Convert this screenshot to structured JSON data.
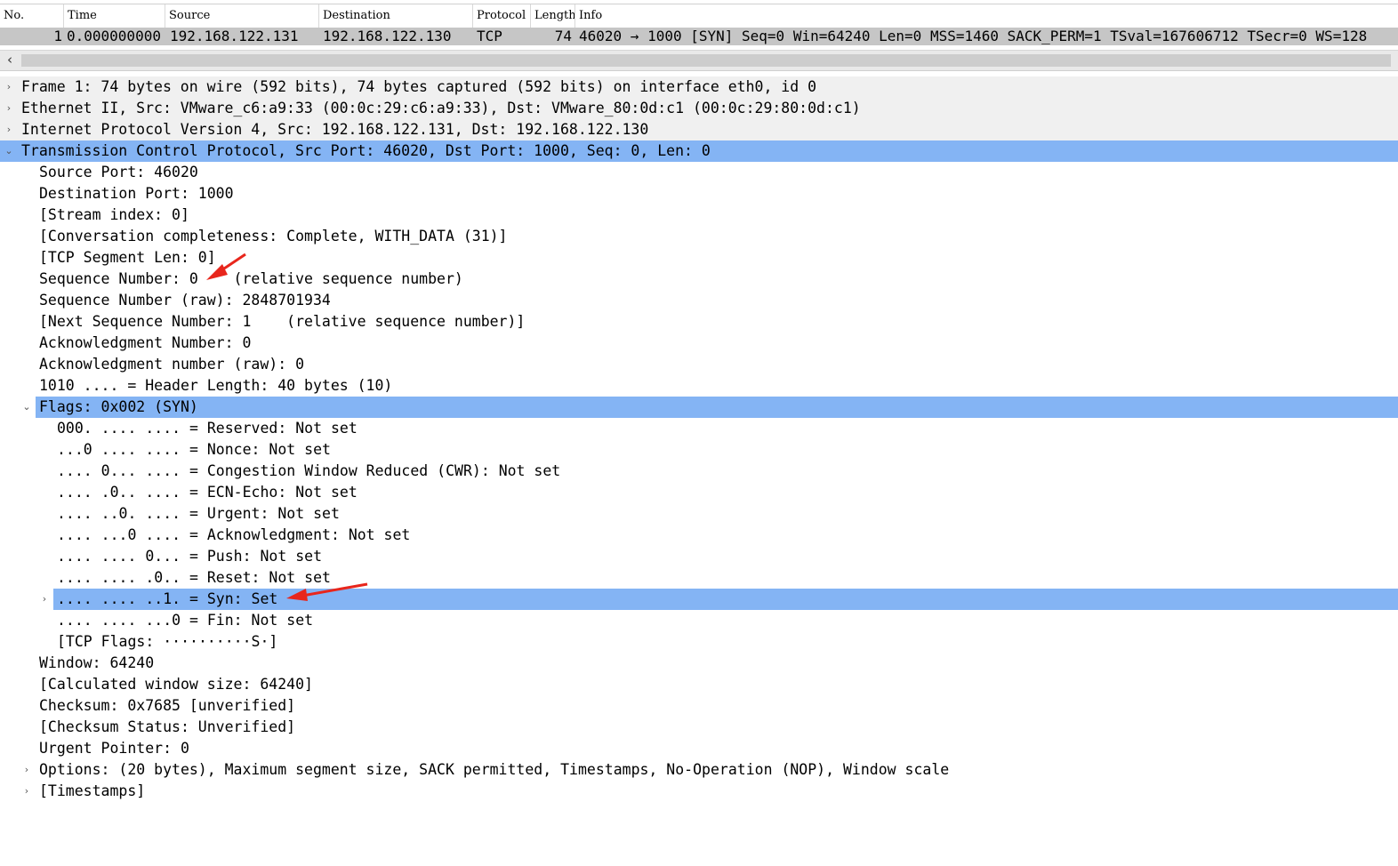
{
  "packet_list": {
    "columns": [
      "No.",
      "Time",
      "Source",
      "Destination",
      "Protocol",
      "Length",
      "Info"
    ],
    "row": {
      "no": "1",
      "time": "0.000000000",
      "source": "192.168.122.131",
      "destination": "192.168.122.130",
      "protocol": "TCP",
      "length": "74",
      "info": "46020 → 1000 [SYN] Seq=0 Win=64240 Len=0 MSS=1460 SACK_PERM=1 TSval=167606712 TSecr=0 WS=128"
    },
    "scroll_left_icon": "‹"
  },
  "tree": {
    "frame": "Frame 1: 74 bytes on wire (592 bits), 74 bytes captured (592 bits) on interface eth0, id 0",
    "ethernet": "Ethernet II, Src: VMware_c6:a9:33 (00:0c:29:c6:a9:33), Dst: VMware_80:0d:c1 (00:0c:29:80:0d:c1)",
    "ip": "Internet Protocol Version 4, Src: 192.168.122.131, Dst: 192.168.122.130",
    "tcp": "Transmission Control Protocol, Src Port: 46020, Dst Port: 1000, Seq: 0, Len: 0",
    "tcp_fields": {
      "src_port": "Source Port: 46020",
      "dst_port": "Destination Port: 1000",
      "stream_index": "[Stream index: 0]",
      "conversation": "[Conversation completeness: Complete, WITH_DATA (31)]",
      "segment_len": "[TCP Segment Len: 0]",
      "seq": "Sequence Number: 0    (relative sequence number)",
      "seq_raw": "Sequence Number (raw): 2848701934",
      "next_seq": "[Next Sequence Number: 1    (relative sequence number)]",
      "ack": "Acknowledgment Number: 0",
      "ack_raw": "Acknowledgment number (raw): 0",
      "header_len": "1010 .... = Header Length: 40 bytes (10)",
      "flags": "Flags: 0x002 (SYN)",
      "window": "Window: 64240",
      "calc_window": "[Calculated window size: 64240]",
      "checksum": "Checksum: 0x7685 [unverified]",
      "checksum_status": "[Checksum Status: Unverified]",
      "urgent_ptr": "Urgent Pointer: 0",
      "options": "Options: (20 bytes), Maximum segment size, SACK permitted, Timestamps, No-Operation (NOP), Window scale",
      "timestamps": "[Timestamps]"
    },
    "flag_bits": {
      "reserved": "000. .... .... = Reserved: Not set",
      "nonce": "...0 .... .... = Nonce: Not set",
      "cwr": ".... 0... .... = Congestion Window Reduced (CWR): Not set",
      "ecn": ".... .0.. .... = ECN-Echo: Not set",
      "urg": ".... ..0. .... = Urgent: Not set",
      "ackf": ".... ...0 .... = Acknowledgment: Not set",
      "push": ".... .... 0... = Push: Not set",
      "reset": ".... .... .0.. = Reset: Not set",
      "syn": ".... .... ..1. = Syn: Set",
      "fin": ".... .... ...0 = Fin: Not set",
      "tcp_flags": "[TCP Flags: ··········S·]"
    },
    "icons": {
      "collapsed": "›",
      "expanded": "⌄"
    }
  },
  "colors": {
    "selected": "#84b4f4",
    "packet_row": "#c6c6c6",
    "annotation_arrow": "#e8261c"
  }
}
